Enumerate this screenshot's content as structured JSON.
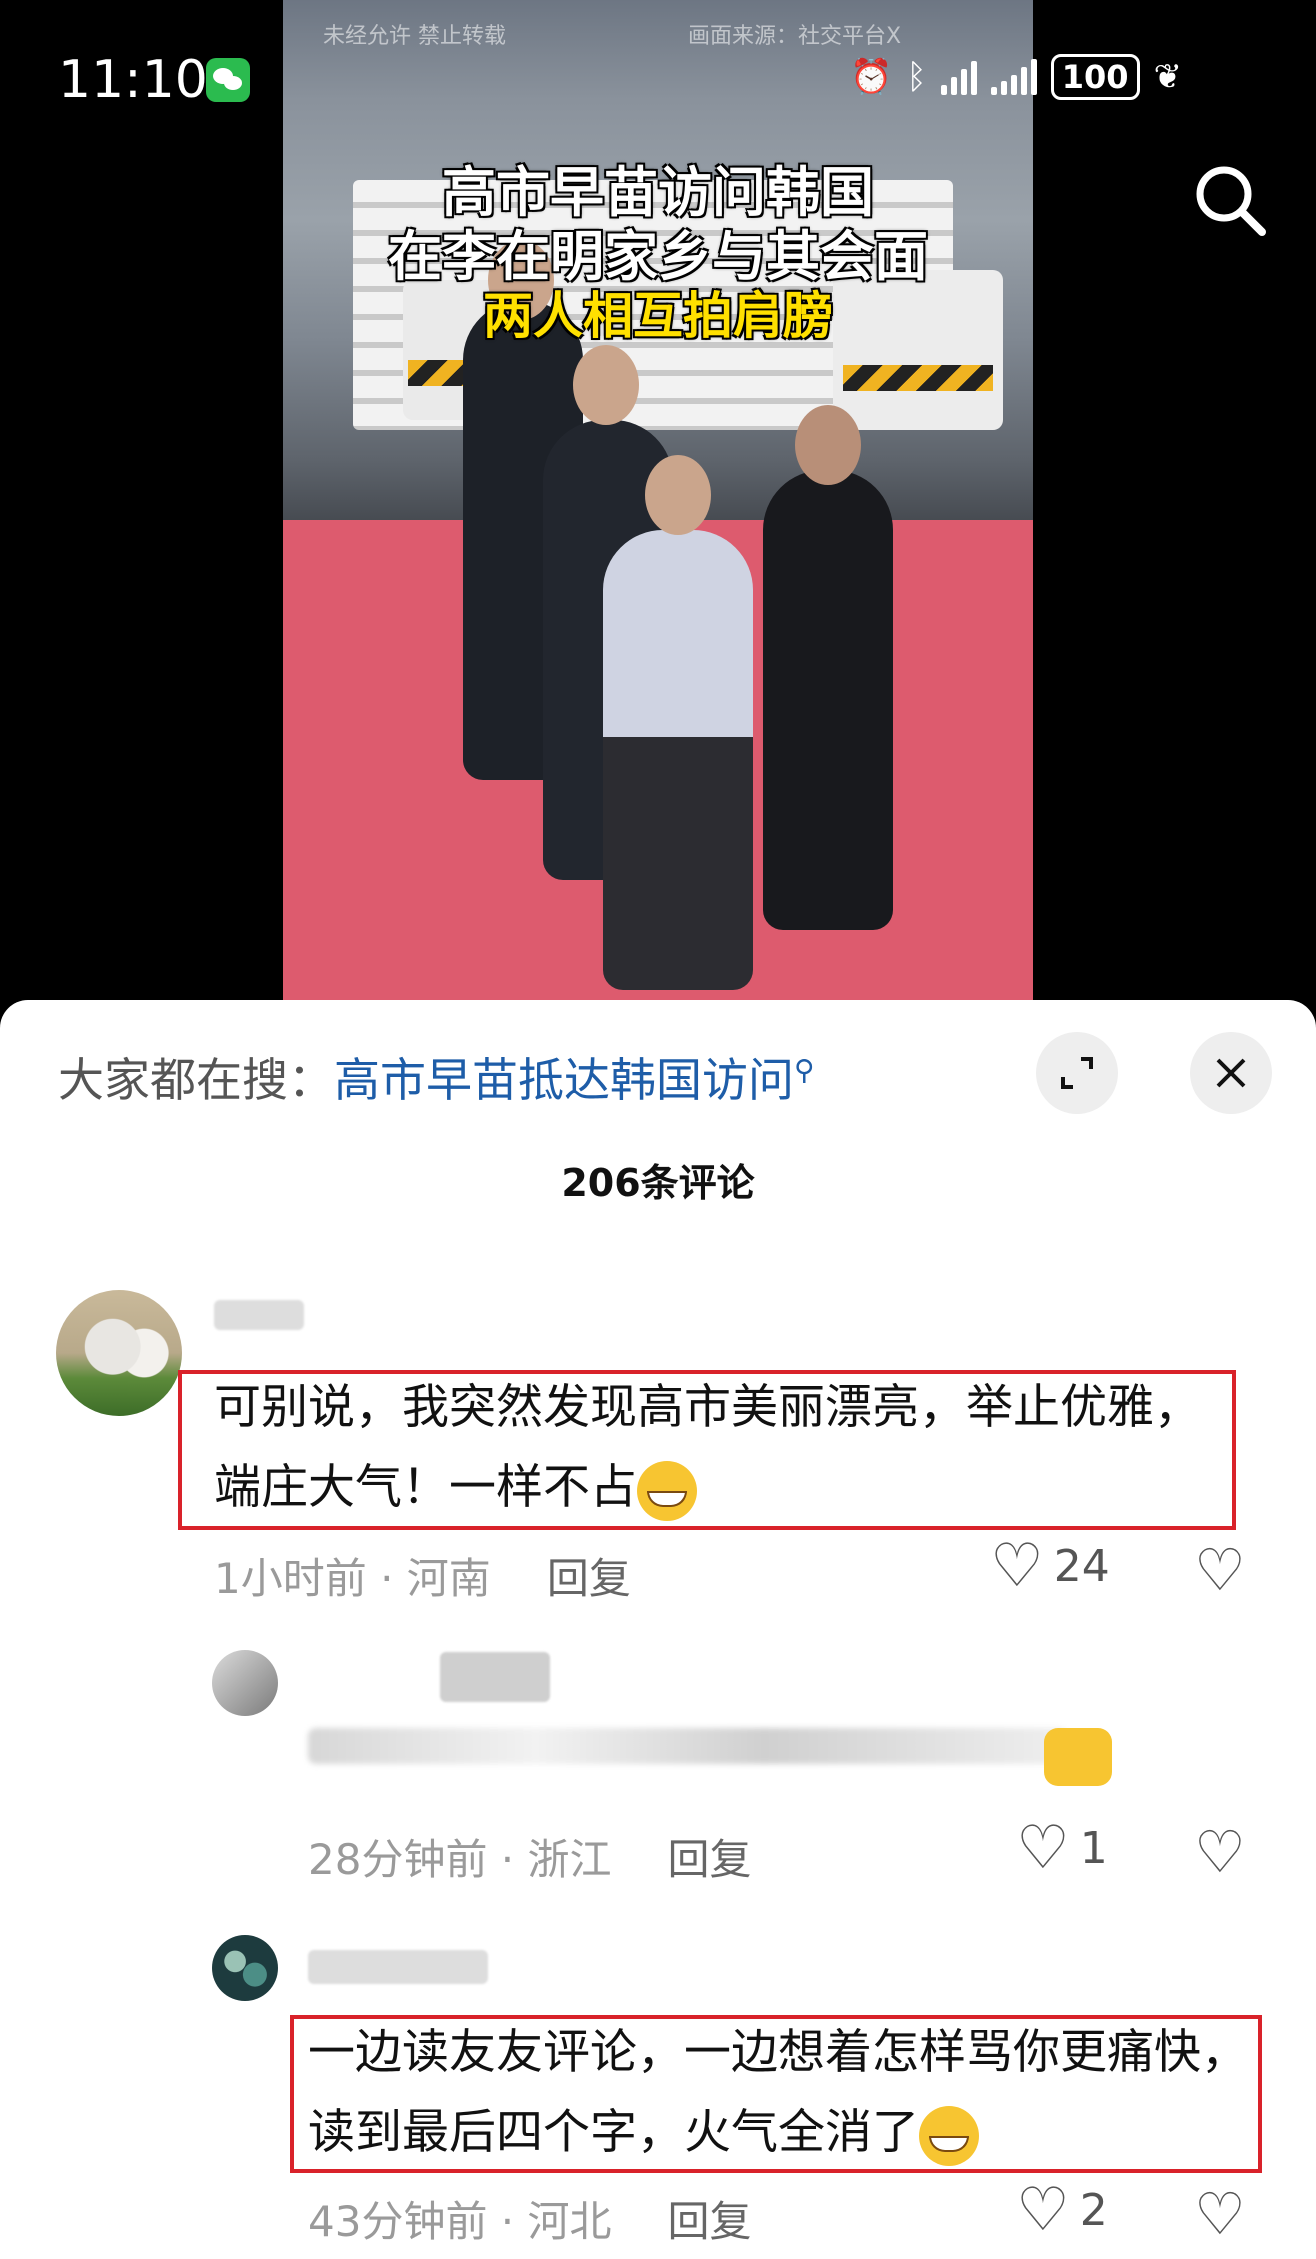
{
  "status_bar": {
    "time": "11:10",
    "battery": "100"
  },
  "video": {
    "watermark_left": "未经允许 禁止转载",
    "watermark_right": "画面来源：社交平台X",
    "caption_line1": "高市早苗访问韩国",
    "caption_line2": "在李在明家乡与其会面",
    "caption_line3": "两人相互拍肩膀"
  },
  "sheet": {
    "hot_search_label": "大家都在搜：",
    "hot_search_keyword": "高市早苗抵达韩国访问",
    "comment_count": "206条评论"
  },
  "comments": [
    {
      "text": "可别说，我突然发现高市美丽漂亮，举止优雅，端庄大气！一样不占",
      "time": "1小时前",
      "location": "河南",
      "reply": "回复",
      "likes": "24"
    },
    {
      "time": "28分钟前",
      "location": "浙江",
      "reply": "回复",
      "likes": "1"
    },
    {
      "text": "一边读友友评论，一边想着怎样骂你更痛快，读到最后四个字，火气全消了",
      "time": "43分钟前",
      "location": "河北",
      "reply": "回复",
      "likes": "2"
    }
  ],
  "meta_separator": " · ",
  "colors": {
    "highlight": "#d9222a",
    "keyword": "#1e5da8"
  }
}
